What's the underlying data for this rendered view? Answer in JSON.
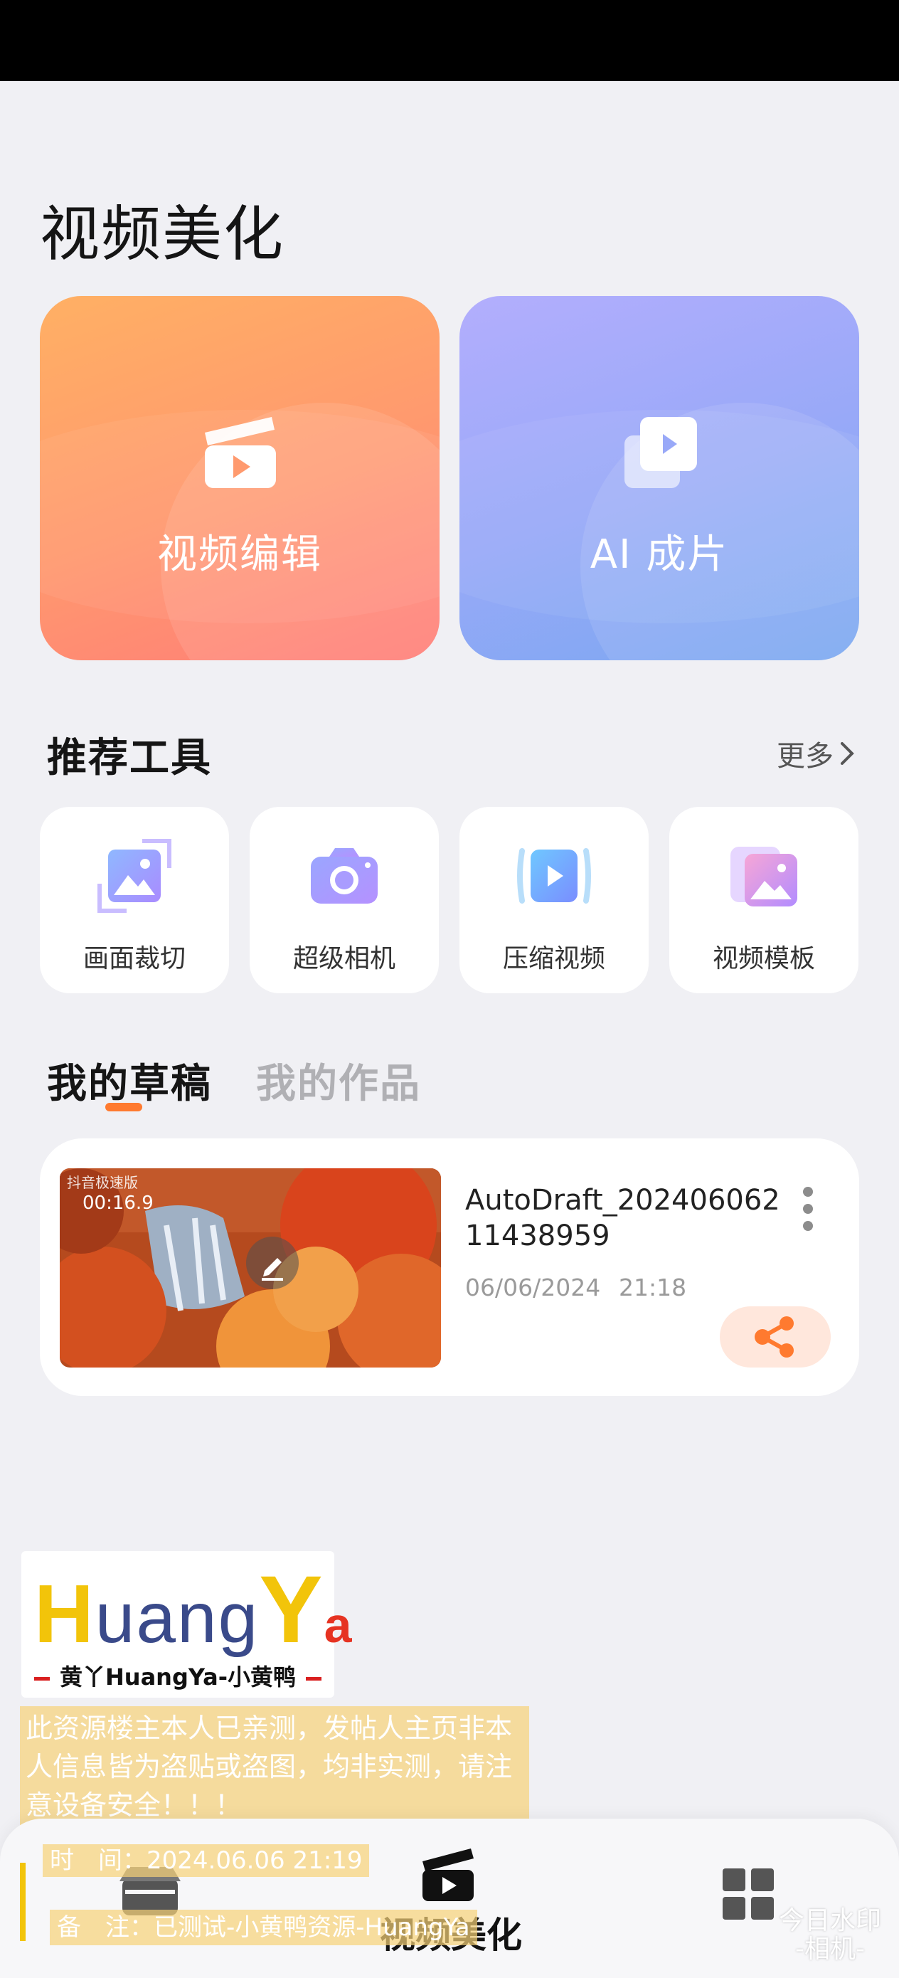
{
  "page": {
    "title": "视频美化"
  },
  "hero": {
    "edit_label": "视频编辑",
    "ai_label": "AI 成片"
  },
  "tools": {
    "section_title": "推荐工具",
    "more_label": "更多",
    "items": [
      {
        "label": "画面裁切",
        "icon": "crop-icon"
      },
      {
        "label": "超级相机",
        "icon": "camera-icon"
      },
      {
        "label": "压缩视频",
        "icon": "compress-video-icon"
      },
      {
        "label": "视频模板",
        "icon": "template-icon"
      }
    ]
  },
  "tabs": {
    "drafts": "我的草稿",
    "works": "我的作品"
  },
  "draft": {
    "thumb_brand": "抖音极速版",
    "duration": "00:16.9",
    "name": "AutoDraft_20240606211438959",
    "date": "06/06/2024",
    "time": "21:18"
  },
  "watermark": {
    "logo_h": "H",
    "logo_uang": "uang",
    "logo_y": "Y",
    "logo_a": "a",
    "logo_subtitle": "黄丫HuangYa-小黄鸭",
    "warning": "此资源楼主本人已亲测，发帖人主页非本人信息皆为盗贴或盗图，均非实测，请注意设备安全！！！",
    "time": "时　间：2024.06.06 21:19",
    "note": "备　注：已测试-小黄鸭资源-HuangYa",
    "stamp": "今日水印 -相机-"
  },
  "bottom_nav": {
    "edit_label": "视频美化"
  },
  "colors": {
    "accent": "#ff7a2f",
    "hero_edit": "#ff9a6e",
    "hero_ai": "#99a9f8",
    "share_bg": "#ffe7dc"
  }
}
